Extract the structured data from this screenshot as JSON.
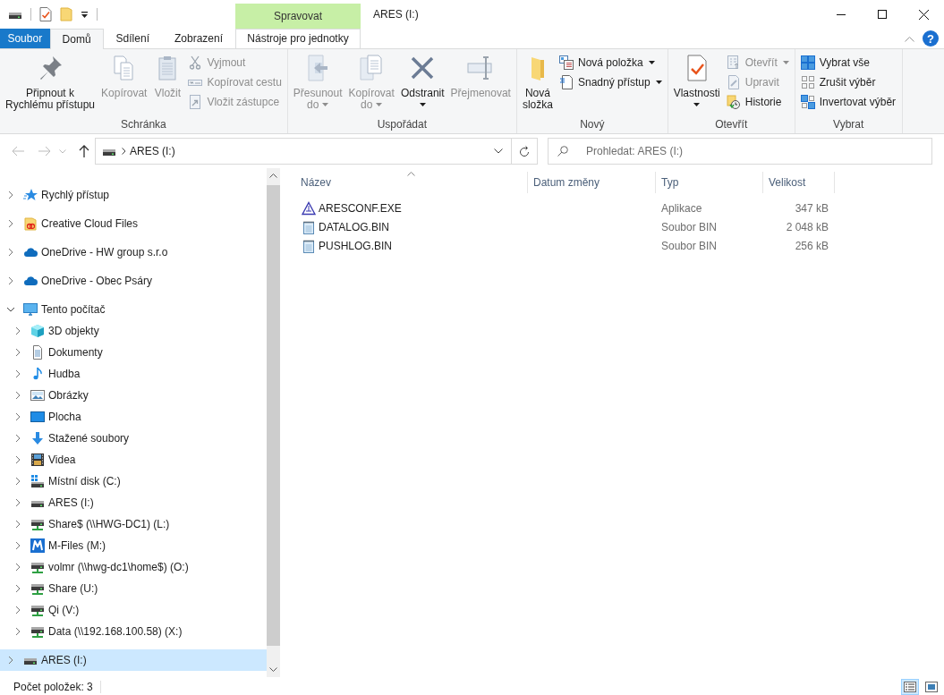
{
  "title_bar": {
    "context_group": "Spravovat",
    "title": "ARES (I:)"
  },
  "ribbon_tabs": [
    {
      "label": "Soubor",
      "kind": "file",
      "selected": false
    },
    {
      "label": "Domů",
      "kind": "tab",
      "selected": true
    },
    {
      "label": "Sdílení",
      "kind": "tab",
      "selected": false
    },
    {
      "label": "Zobrazení",
      "kind": "tab",
      "selected": false
    },
    {
      "label": "Nástroje pro jednotky",
      "kind": "context",
      "selected": false
    }
  ],
  "help_button": {
    "label": "?"
  },
  "ribbon": [
    {
      "label": "Schránka",
      "buttons": [
        {
          "kind": "large",
          "label": "Připnout k\nRychlému přístupu",
          "disabled": false,
          "dropdown": false
        },
        {
          "kind": "large",
          "label": "Kopírovat",
          "disabled": true,
          "dropdown": false
        },
        {
          "kind": "large",
          "label": "Vložit",
          "disabled": true,
          "dropdown": false
        },
        {
          "kind": "small",
          "label": "Vyjmout",
          "disabled": true,
          "dropdown": false
        },
        {
          "kind": "small",
          "label": "Kopírovat cestu",
          "disabled": true,
          "dropdown": false
        },
        {
          "kind": "small",
          "label": "Vložit zástupce",
          "disabled": true,
          "dropdown": false
        }
      ]
    },
    {
      "label": "Uspořádat",
      "buttons": [
        {
          "kind": "large",
          "label": "Přesunout\ndo",
          "disabled": true,
          "dropdown": true
        },
        {
          "kind": "large",
          "label": "Kopírovat\ndo",
          "disabled": true,
          "dropdown": true
        },
        {
          "kind": "large",
          "label": "Odstranit",
          "disabled": false,
          "dropdown": true
        },
        {
          "kind": "large",
          "label": "Přejmenovat",
          "disabled": true,
          "dropdown": false
        }
      ]
    },
    {
      "label": "Nový",
      "buttons": [
        {
          "kind": "large",
          "label": "Nová\nsložka",
          "disabled": false,
          "dropdown": false
        },
        {
          "kind": "small",
          "label": "Nová položka",
          "disabled": false,
          "dropdown": true
        },
        {
          "kind": "small",
          "label": "Snadný přístup",
          "disabled": false,
          "dropdown": true
        }
      ]
    },
    {
      "label": "Otevřít",
      "buttons": [
        {
          "kind": "large",
          "label": "Vlastnosti",
          "disabled": false,
          "dropdown": true
        },
        {
          "kind": "small",
          "label": "Otevřít",
          "disabled": true,
          "dropdown": true
        },
        {
          "kind": "small",
          "label": "Upravit",
          "disabled": true,
          "dropdown": false
        },
        {
          "kind": "small",
          "label": "Historie",
          "disabled": false,
          "dropdown": false
        }
      ]
    },
    {
      "label": "Vybrat",
      "buttons": [
        {
          "kind": "small",
          "label": "Vybrat vše",
          "disabled": false,
          "dropdown": false
        },
        {
          "kind": "small",
          "label": "Zrušit výběr",
          "disabled": false,
          "dropdown": false
        },
        {
          "kind": "small",
          "label": "Invertovat výběr",
          "disabled": false,
          "dropdown": false
        }
      ]
    }
  ],
  "address_bar": {
    "path": "ARES (I:)",
    "search_placeholder": "Prohledat: ARES (I:)"
  },
  "navigation": [
    {
      "label": "Rychlý přístup",
      "expanded": false,
      "selected": false
    },
    {
      "label": "Creative Cloud Files",
      "expanded": false,
      "selected": false
    },
    {
      "label": "OneDrive - HW group s.r.o",
      "expanded": false,
      "selected": false
    },
    {
      "label": "OneDrive - Obec Psáry",
      "expanded": false,
      "selected": false
    },
    {
      "label": "Tento počítač",
      "expanded": true,
      "selected": false,
      "children": [
        {
          "label": "3D objekty",
          "expanded": false,
          "selected": false
        },
        {
          "label": "Dokumenty",
          "expanded": false,
          "selected": false
        },
        {
          "label": "Hudba",
          "expanded": false,
          "selected": false
        },
        {
          "label": "Obrázky",
          "expanded": false,
          "selected": false
        },
        {
          "label": "Plocha",
          "expanded": false,
          "selected": false
        },
        {
          "label": "Stažené soubory",
          "expanded": false,
          "selected": false
        },
        {
          "label": "Videa",
          "expanded": false,
          "selected": false
        },
        {
          "label": "Místní disk (C:)",
          "expanded": false,
          "selected": false
        },
        {
          "label": "ARES (I:)",
          "expanded": false,
          "selected": false
        },
        {
          "label": "Share$ (\\\\HWG-DC1) (L:)",
          "expanded": false,
          "selected": false
        },
        {
          "label": "M-Files (M:)",
          "expanded": false,
          "selected": false
        },
        {
          "label": "volmr (\\\\hwg-dc1\\home$) (O:)",
          "expanded": false,
          "selected": false
        },
        {
          "label": "Share (U:)",
          "expanded": false,
          "selected": false
        },
        {
          "label": "Qi (V:)",
          "expanded": false,
          "selected": false
        },
        {
          "label": "Data (\\\\192.168.100.58) (X:)",
          "expanded": false,
          "selected": false
        }
      ]
    },
    {
      "label": "ARES (I:)",
      "expanded": false,
      "selected": true
    }
  ],
  "table": {
    "columns": [
      {
        "label": "Název",
        "sorted": true
      },
      {
        "label": "Datum změny",
        "sorted": false
      },
      {
        "label": "Typ",
        "sorted": false
      },
      {
        "label": "Velikost",
        "sorted": false
      }
    ],
    "rows": [
      {
        "kind": "application",
        "name": "ARESCONF.EXE",
        "type": "Aplikace",
        "size": "347 kB"
      },
      {
        "kind": "file",
        "name": "DATALOG.BIN",
        "type": "Soubor BIN",
        "size": "2 048 kB"
      },
      {
        "kind": "file",
        "name": "PUSHLOG.BIN",
        "type": "Soubor BIN",
        "size": "256 kB"
      }
    ]
  },
  "status_bar": {
    "text": "Počet položek: 3",
    "views": [
      {
        "selected": true
      },
      {
        "selected": false
      }
    ]
  }
}
